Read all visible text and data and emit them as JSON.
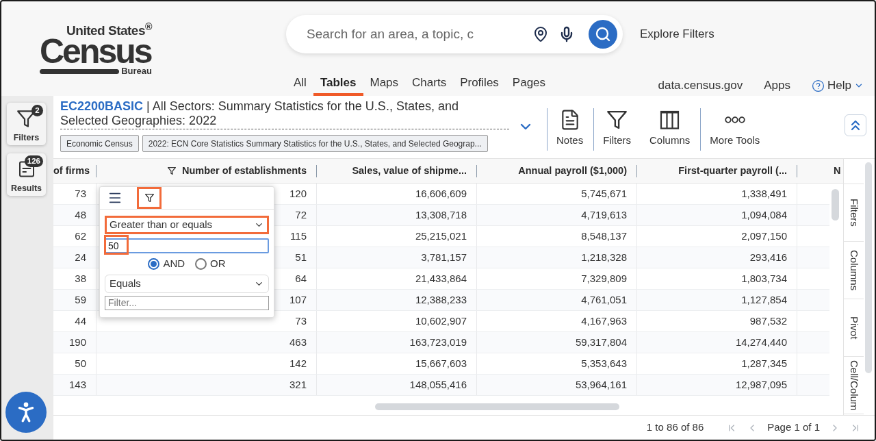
{
  "header": {
    "logo": {
      "top": "United States$^{®}$",
      "main": "Census",
      "bottom": "Bureau"
    },
    "search": {
      "placeholder": "Search for an area, a topic, c"
    },
    "explore_link": "Explore Filters",
    "nav": [
      {
        "label": "All",
        "selected": false
      },
      {
        "label": "Tables",
        "selected": true
      },
      {
        "label": "Maps",
        "selected": false
      },
      {
        "label": "Charts",
        "selected": false
      },
      {
        "label": "Profiles",
        "selected": false
      },
      {
        "label": "Pages",
        "selected": false
      }
    ],
    "links": [
      {
        "kind": "link",
        "label": "data.census.gov"
      },
      {
        "kind": "link",
        "label": "Apps"
      },
      {
        "kind": "help",
        "label": "Help"
      }
    ]
  },
  "rail": [
    {
      "kind": "filters",
      "label": "Filters",
      "badge": "2"
    },
    {
      "kind": "results",
      "label": "Results",
      "badge": "126"
    }
  ],
  "table_title": {
    "id": "EC2200BASIC",
    "separator": "|",
    "title": "All Sectors: Summary Statistics for the U.S., States, and Selected Geographies: 2022",
    "tags": [
      "Economic Census",
      "2022: ECN Core Statistics Summary Statistics for the U.S., States, and Selected Geograp..."
    ]
  },
  "toolbar": [
    {
      "kind": "notes",
      "label": "Notes",
      "divider_before": true
    },
    {
      "kind": "filters",
      "label": "Filters",
      "divider_before": true
    },
    {
      "kind": "columns",
      "label": "Columns",
      "divider_before": false
    },
    {
      "kind": "more",
      "label": "More Tools",
      "divider_before": true
    }
  ],
  "grid": {
    "columns": [
      {
        "label": "of firms",
        "filtered": false
      },
      {
        "label": "Number of establishments",
        "filtered": true
      },
      {
        "label": "Sales, value of shipme...",
        "filtered": false
      },
      {
        "label": "Annual payroll ($1,000)",
        "filtered": false
      },
      {
        "label": "First-quarter payroll (...",
        "filtered": false
      },
      {
        "label": "N",
        "filtered": false
      }
    ],
    "rows": [
      [
        "73",
        "120",
        "16,606,609",
        "5,745,671",
        "1,338,491"
      ],
      [
        "48",
        "72",
        "13,308,718",
        "4,719,613",
        "1,094,084"
      ],
      [
        "62",
        "115",
        "25,215,021",
        "8,548,137",
        "2,097,150"
      ],
      [
        "24",
        "51",
        "3,781,157",
        "1,218,328",
        "293,416"
      ],
      [
        "38",
        "64",
        "21,433,864",
        "7,329,809",
        "1,803,734"
      ],
      [
        "59",
        "107",
        "12,388,233",
        "4,761,051",
        "1,127,854"
      ],
      [
        "44",
        "73",
        "10,602,907",
        "4,167,963",
        "987,532"
      ],
      [
        "190",
        "463",
        "163,723,019",
        "59,317,804",
        "14,274,440"
      ],
      [
        "50",
        "142",
        "15,667,603",
        "5,353,643",
        "1,287,345"
      ],
      [
        "143",
        "321",
        "148,055,416",
        "53,964,161",
        "12,987,095"
      ]
    ]
  },
  "filter_menu": {
    "tabs": [
      {
        "kind": "menu",
        "highlighted": false
      },
      {
        "kind": "filter",
        "highlighted": true
      }
    ],
    "first_condition": {
      "operator": "Greater than or equals",
      "operator_highlighted": true,
      "value": "50",
      "value_highlighted": true,
      "focused": true
    },
    "join": [
      {
        "label": "AND",
        "selected": true
      },
      {
        "label": "OR",
        "selected": false
      }
    ],
    "second_condition": {
      "operator": "Equals",
      "placeholder": "Filter..."
    }
  },
  "side_tabs": [
    {
      "label": "Filters"
    },
    {
      "label": "Columns"
    },
    {
      "label": "Pivot"
    },
    {
      "label": "Cell/Colum"
    }
  ],
  "footer": {
    "summary": "1 to 86 of 86",
    "pager": [
      {
        "kind": "first",
        "disabled": true
      },
      {
        "kind": "prev",
        "disabled": true
      },
      {
        "kind": "page",
        "label": "Page 1 of 1"
      },
      {
        "kind": "next",
        "disabled": true
      },
      {
        "kind": "last",
        "disabled": true
      }
    ]
  }
}
